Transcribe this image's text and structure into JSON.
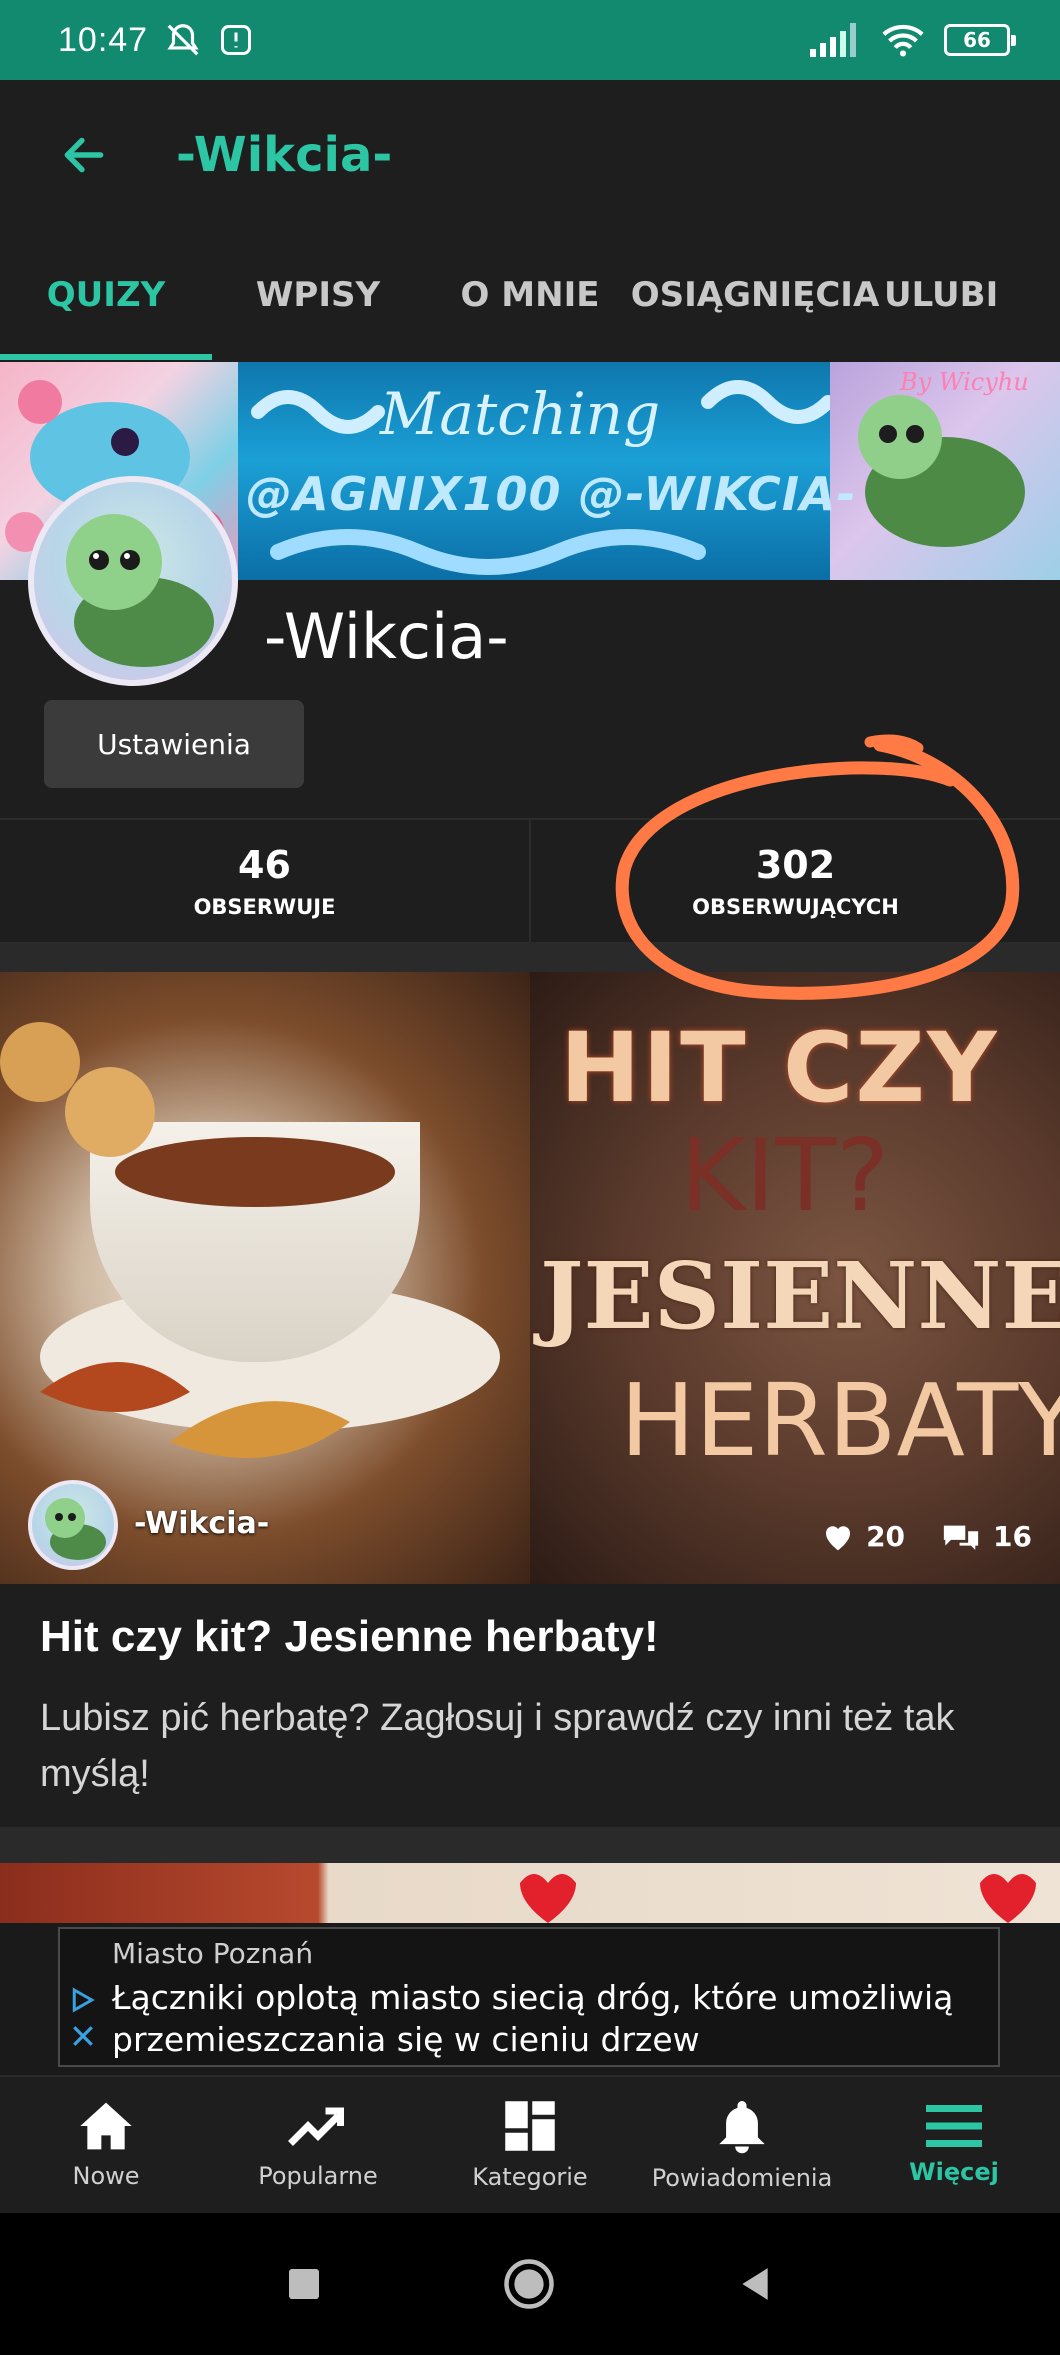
{
  "status_bar": {
    "time": "10:47",
    "battery": "66"
  },
  "header": {
    "title": "-Wikcia-"
  },
  "tabs": [
    {
      "label": "QUIZY",
      "active": true
    },
    {
      "label": "WPISY",
      "active": false
    },
    {
      "label": "O MNIE",
      "active": false
    },
    {
      "label": "OSIĄGNIĘCIA",
      "active": false
    },
    {
      "label": "ULUBI",
      "active": false
    }
  ],
  "banner": {
    "word": "Matching",
    "tags": "@AGNIX100 @-WIKCIA-",
    "signature": "By Wicyhu"
  },
  "profile": {
    "name": "-Wikcia-",
    "settings_label": "Ustawienia"
  },
  "stats": {
    "following_count": "46",
    "following_label": "OBSERWUJE",
    "followers_count": "302",
    "followers_label": "OBSERWUJĄCYCH"
  },
  "quiz_card": {
    "image_text": {
      "line1": "HIT CZY",
      "line2": "KIT?",
      "line3": "JESIENNE",
      "line4": "HERBATY!"
    },
    "author": "-Wikcia-",
    "likes": "20",
    "comments": "16",
    "title": "Hit czy kit? Jesienne herbaty!",
    "description": "Lubisz pić herbatę? Zagłosuj i sprawdź czy inni też tak myślą!"
  },
  "ad": {
    "source": "Miasto Poznań",
    "text": "Łączniki oplotą miasto siecią dróg, które umożliwią przemieszczania się w cieniu drzew"
  },
  "bottom_nav": [
    {
      "label": "Nowe",
      "icon": "home-icon"
    },
    {
      "label": "Popularne",
      "icon": "trending-icon"
    },
    {
      "label": "Kategorie",
      "icon": "grid-icon"
    },
    {
      "label": "Powiadomienia",
      "icon": "bell-icon"
    },
    {
      "label": "Więcej",
      "icon": "menu-icon",
      "active": true
    }
  ],
  "colors": {
    "accent": "#2cc6a4",
    "status_bar": "#128a70",
    "highlight": "#ff7a45"
  }
}
